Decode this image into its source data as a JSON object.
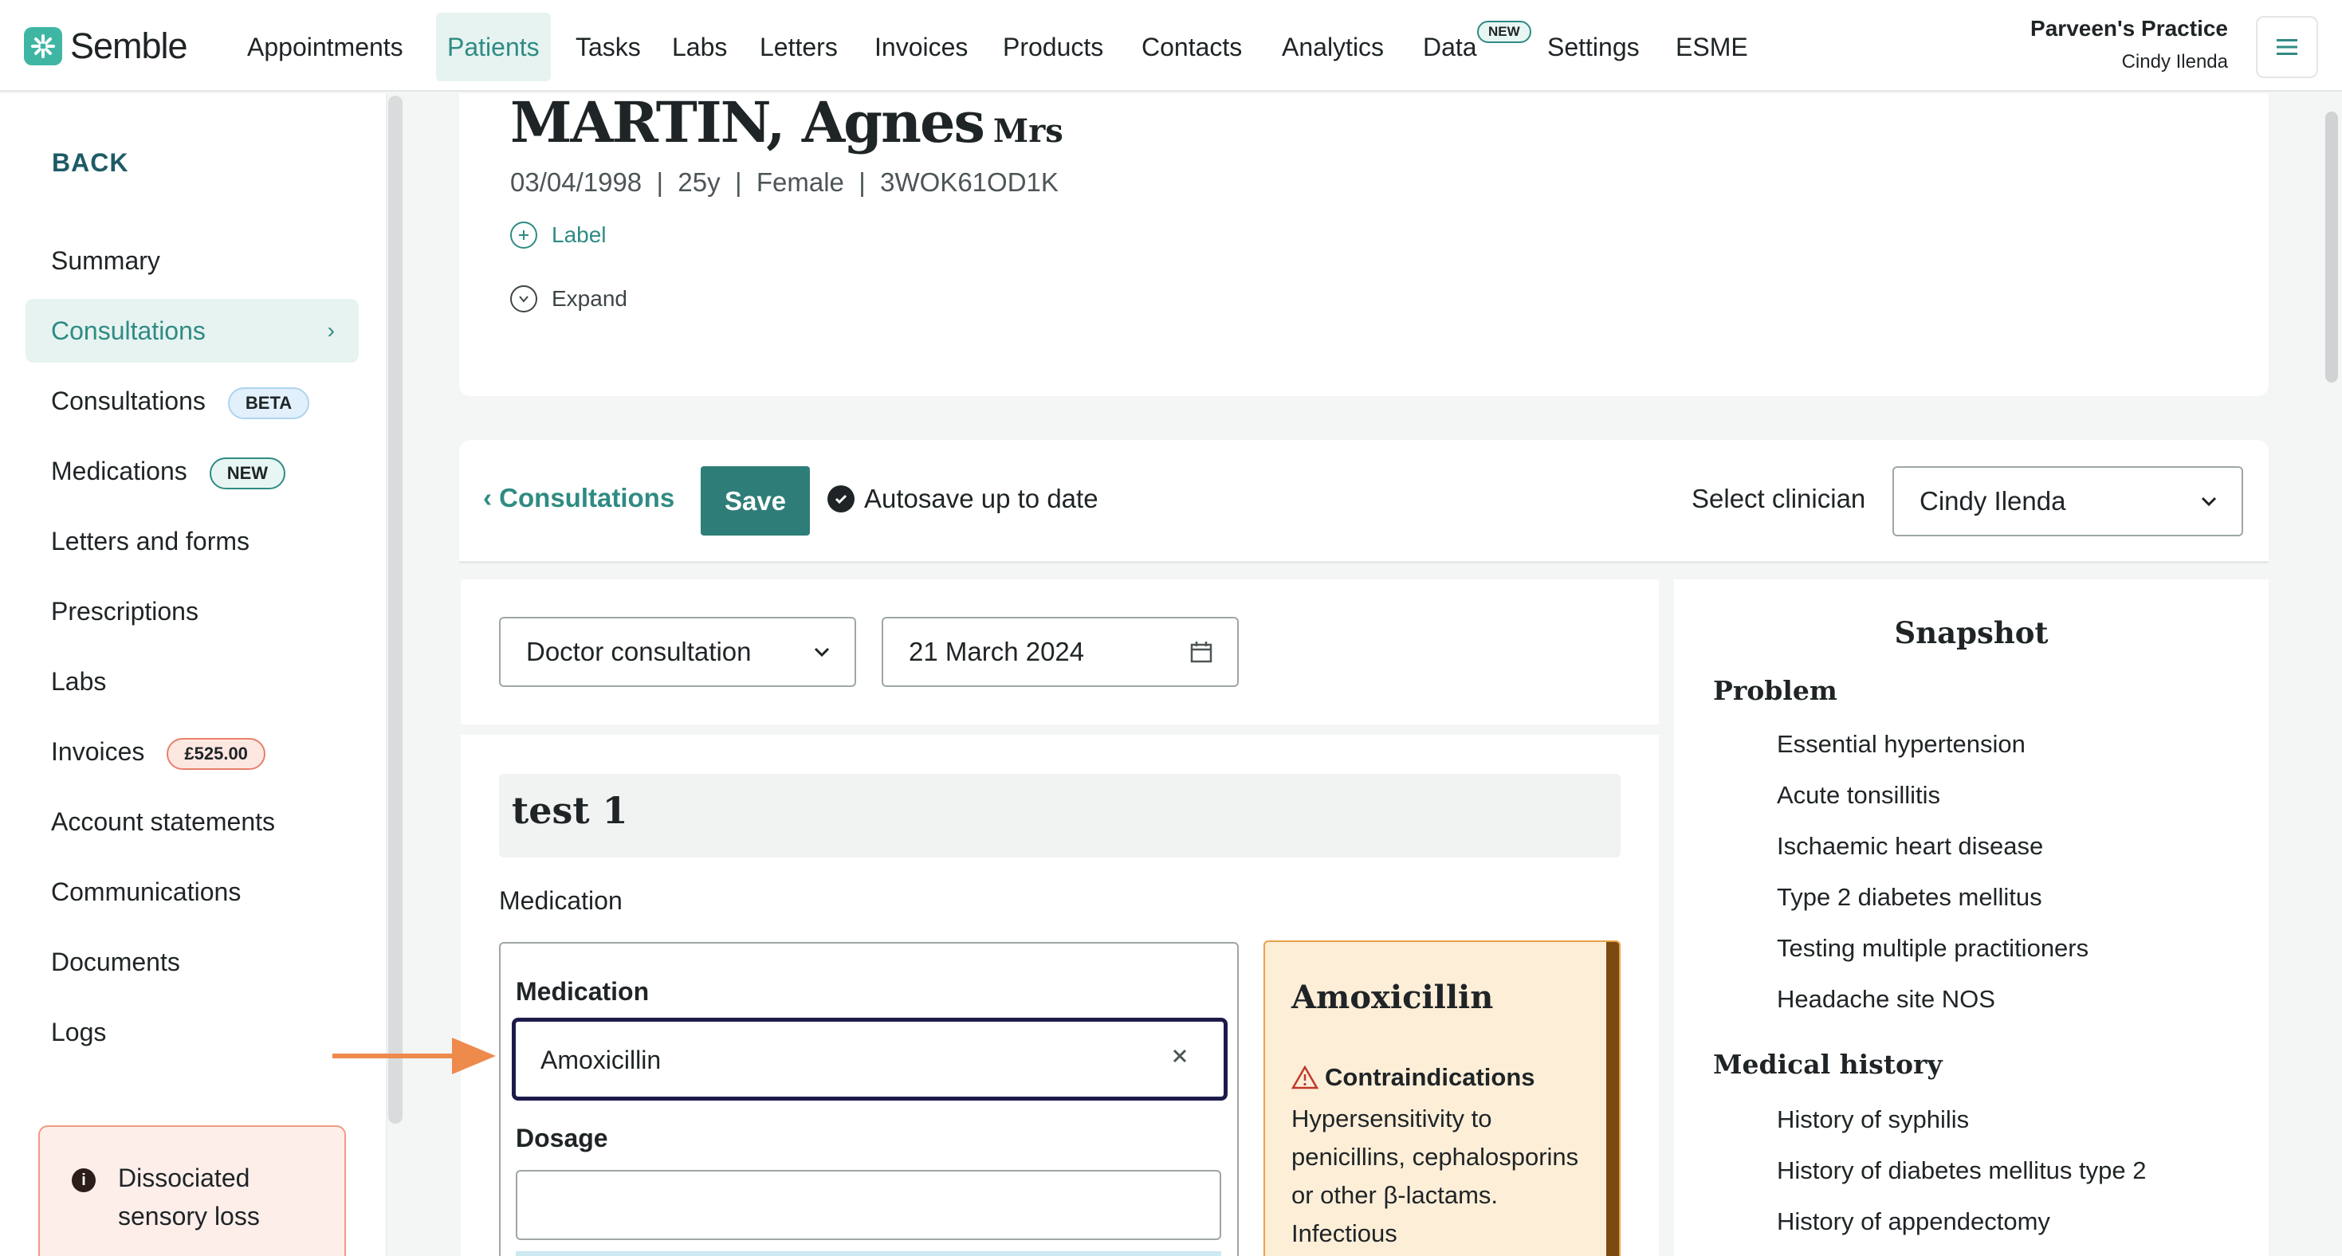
{
  "app": {
    "brand": "Semble",
    "accent_color": "#2f8b83",
    "nav": [
      {
        "label": "Appointments"
      },
      {
        "label": "Patients"
      },
      {
        "label": "Tasks"
      },
      {
        "label": "Labs"
      },
      {
        "label": "Letters"
      },
      {
        "label": "Invoices"
      },
      {
        "label": "Products"
      },
      {
        "label": "Contacts"
      },
      {
        "label": "Analytics"
      },
      {
        "label": "Data",
        "badge": "NEW"
      },
      {
        "label": "Settings"
      },
      {
        "label": "ESME"
      }
    ],
    "active_nav": "Patients",
    "practice_name": "Parveen's Practice",
    "user_name": "Cindy Ilenda",
    "menu_icon": "hamburger-icon"
  },
  "sidebar": {
    "back_label": "BACK",
    "items": [
      {
        "label": "Summary"
      },
      {
        "label": "Consultations",
        "active": true
      },
      {
        "label": "Consultations",
        "badge": "BETA"
      },
      {
        "label": "Medications",
        "badge": "NEW"
      },
      {
        "label": "Letters and forms"
      },
      {
        "label": "Prescriptions"
      },
      {
        "label": "Labs"
      },
      {
        "label": "Invoices",
        "badge": "£525.00"
      },
      {
        "label": "Account statements"
      },
      {
        "label": "Communications"
      },
      {
        "label": "Documents"
      },
      {
        "label": "Logs"
      }
    ],
    "alert": {
      "icon": "info-icon",
      "text": "Dissociated sensory loss"
    }
  },
  "patient": {
    "name": "MARTIN, Agnes",
    "title": "Mrs",
    "meta": "03/04/1998  |  25y  |  Female  |  3WOK61OD1K",
    "label_link": "Label",
    "expand_link": "Expand"
  },
  "toolbar": {
    "back_label": "Consultations",
    "save_label": "Save",
    "autosave_text": "Autosave up to date",
    "clinician_label": "Select clinician",
    "clinician_value": "Cindy Ilenda"
  },
  "consultation": {
    "type_value": "Doctor consultation",
    "date_value": "21 March 2024",
    "section_title": "test 1",
    "section_heading": "Medication",
    "medication_label": "Medication",
    "medication_value": "Amoxicillin",
    "dosage_label": "Dosage",
    "dosage_value": ""
  },
  "drug_info": {
    "name": "Amoxicillin",
    "contra_title": "Contraindications",
    "contra_text": "Hypersensitivity to penicillins, cephalosporins or other β-lactams. Infectious",
    "warning_color": "#c0392b"
  },
  "snapshot": {
    "title": "Snapshot",
    "problem_heading": "Problem",
    "problems": [
      "Essential hypertension",
      "Acute tonsillitis",
      "Ischaemic heart disease",
      "Type 2 diabetes mellitus",
      "Testing multiple practitioners",
      "Headache site NOS"
    ],
    "history_heading": "Medical history",
    "history": [
      "History of syphilis",
      "History of diabetes mellitus type 2",
      "History of appendectomy"
    ]
  }
}
